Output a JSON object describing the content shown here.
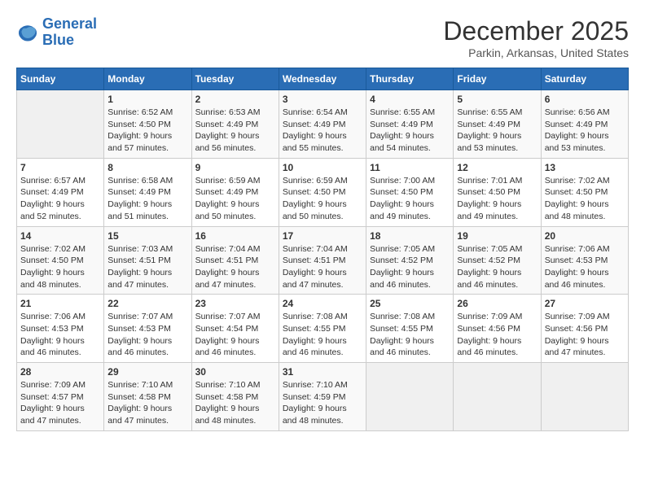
{
  "header": {
    "logo_line1": "General",
    "logo_line2": "Blue",
    "month_title": "December 2025",
    "location": "Parkin, Arkansas, United States"
  },
  "days_of_week": [
    "Sunday",
    "Monday",
    "Tuesday",
    "Wednesday",
    "Thursday",
    "Friday",
    "Saturday"
  ],
  "weeks": [
    [
      {
        "day": "",
        "info": ""
      },
      {
        "day": "1",
        "info": "Sunrise: 6:52 AM\nSunset: 4:50 PM\nDaylight: 9 hours\nand 57 minutes."
      },
      {
        "day": "2",
        "info": "Sunrise: 6:53 AM\nSunset: 4:49 PM\nDaylight: 9 hours\nand 56 minutes."
      },
      {
        "day": "3",
        "info": "Sunrise: 6:54 AM\nSunset: 4:49 PM\nDaylight: 9 hours\nand 55 minutes."
      },
      {
        "day": "4",
        "info": "Sunrise: 6:55 AM\nSunset: 4:49 PM\nDaylight: 9 hours\nand 54 minutes."
      },
      {
        "day": "5",
        "info": "Sunrise: 6:55 AM\nSunset: 4:49 PM\nDaylight: 9 hours\nand 53 minutes."
      },
      {
        "day": "6",
        "info": "Sunrise: 6:56 AM\nSunset: 4:49 PM\nDaylight: 9 hours\nand 53 minutes."
      }
    ],
    [
      {
        "day": "7",
        "info": "Sunrise: 6:57 AM\nSunset: 4:49 PM\nDaylight: 9 hours\nand 52 minutes."
      },
      {
        "day": "8",
        "info": "Sunrise: 6:58 AM\nSunset: 4:49 PM\nDaylight: 9 hours\nand 51 minutes."
      },
      {
        "day": "9",
        "info": "Sunrise: 6:59 AM\nSunset: 4:49 PM\nDaylight: 9 hours\nand 50 minutes."
      },
      {
        "day": "10",
        "info": "Sunrise: 6:59 AM\nSunset: 4:50 PM\nDaylight: 9 hours\nand 50 minutes."
      },
      {
        "day": "11",
        "info": "Sunrise: 7:00 AM\nSunset: 4:50 PM\nDaylight: 9 hours\nand 49 minutes."
      },
      {
        "day": "12",
        "info": "Sunrise: 7:01 AM\nSunset: 4:50 PM\nDaylight: 9 hours\nand 49 minutes."
      },
      {
        "day": "13",
        "info": "Sunrise: 7:02 AM\nSunset: 4:50 PM\nDaylight: 9 hours\nand 48 minutes."
      }
    ],
    [
      {
        "day": "14",
        "info": "Sunrise: 7:02 AM\nSunset: 4:50 PM\nDaylight: 9 hours\nand 48 minutes."
      },
      {
        "day": "15",
        "info": "Sunrise: 7:03 AM\nSunset: 4:51 PM\nDaylight: 9 hours\nand 47 minutes."
      },
      {
        "day": "16",
        "info": "Sunrise: 7:04 AM\nSunset: 4:51 PM\nDaylight: 9 hours\nand 47 minutes."
      },
      {
        "day": "17",
        "info": "Sunrise: 7:04 AM\nSunset: 4:51 PM\nDaylight: 9 hours\nand 47 minutes."
      },
      {
        "day": "18",
        "info": "Sunrise: 7:05 AM\nSunset: 4:52 PM\nDaylight: 9 hours\nand 46 minutes."
      },
      {
        "day": "19",
        "info": "Sunrise: 7:05 AM\nSunset: 4:52 PM\nDaylight: 9 hours\nand 46 minutes."
      },
      {
        "day": "20",
        "info": "Sunrise: 7:06 AM\nSunset: 4:53 PM\nDaylight: 9 hours\nand 46 minutes."
      }
    ],
    [
      {
        "day": "21",
        "info": "Sunrise: 7:06 AM\nSunset: 4:53 PM\nDaylight: 9 hours\nand 46 minutes."
      },
      {
        "day": "22",
        "info": "Sunrise: 7:07 AM\nSunset: 4:53 PM\nDaylight: 9 hours\nand 46 minutes."
      },
      {
        "day": "23",
        "info": "Sunrise: 7:07 AM\nSunset: 4:54 PM\nDaylight: 9 hours\nand 46 minutes."
      },
      {
        "day": "24",
        "info": "Sunrise: 7:08 AM\nSunset: 4:55 PM\nDaylight: 9 hours\nand 46 minutes."
      },
      {
        "day": "25",
        "info": "Sunrise: 7:08 AM\nSunset: 4:55 PM\nDaylight: 9 hours\nand 46 minutes."
      },
      {
        "day": "26",
        "info": "Sunrise: 7:09 AM\nSunset: 4:56 PM\nDaylight: 9 hours\nand 46 minutes."
      },
      {
        "day": "27",
        "info": "Sunrise: 7:09 AM\nSunset: 4:56 PM\nDaylight: 9 hours\nand 47 minutes."
      }
    ],
    [
      {
        "day": "28",
        "info": "Sunrise: 7:09 AM\nSunset: 4:57 PM\nDaylight: 9 hours\nand 47 minutes."
      },
      {
        "day": "29",
        "info": "Sunrise: 7:10 AM\nSunset: 4:58 PM\nDaylight: 9 hours\nand 47 minutes."
      },
      {
        "day": "30",
        "info": "Sunrise: 7:10 AM\nSunset: 4:58 PM\nDaylight: 9 hours\nand 48 minutes."
      },
      {
        "day": "31",
        "info": "Sunrise: 7:10 AM\nSunset: 4:59 PM\nDaylight: 9 hours\nand 48 minutes."
      },
      {
        "day": "",
        "info": ""
      },
      {
        "day": "",
        "info": ""
      },
      {
        "day": "",
        "info": ""
      }
    ]
  ]
}
